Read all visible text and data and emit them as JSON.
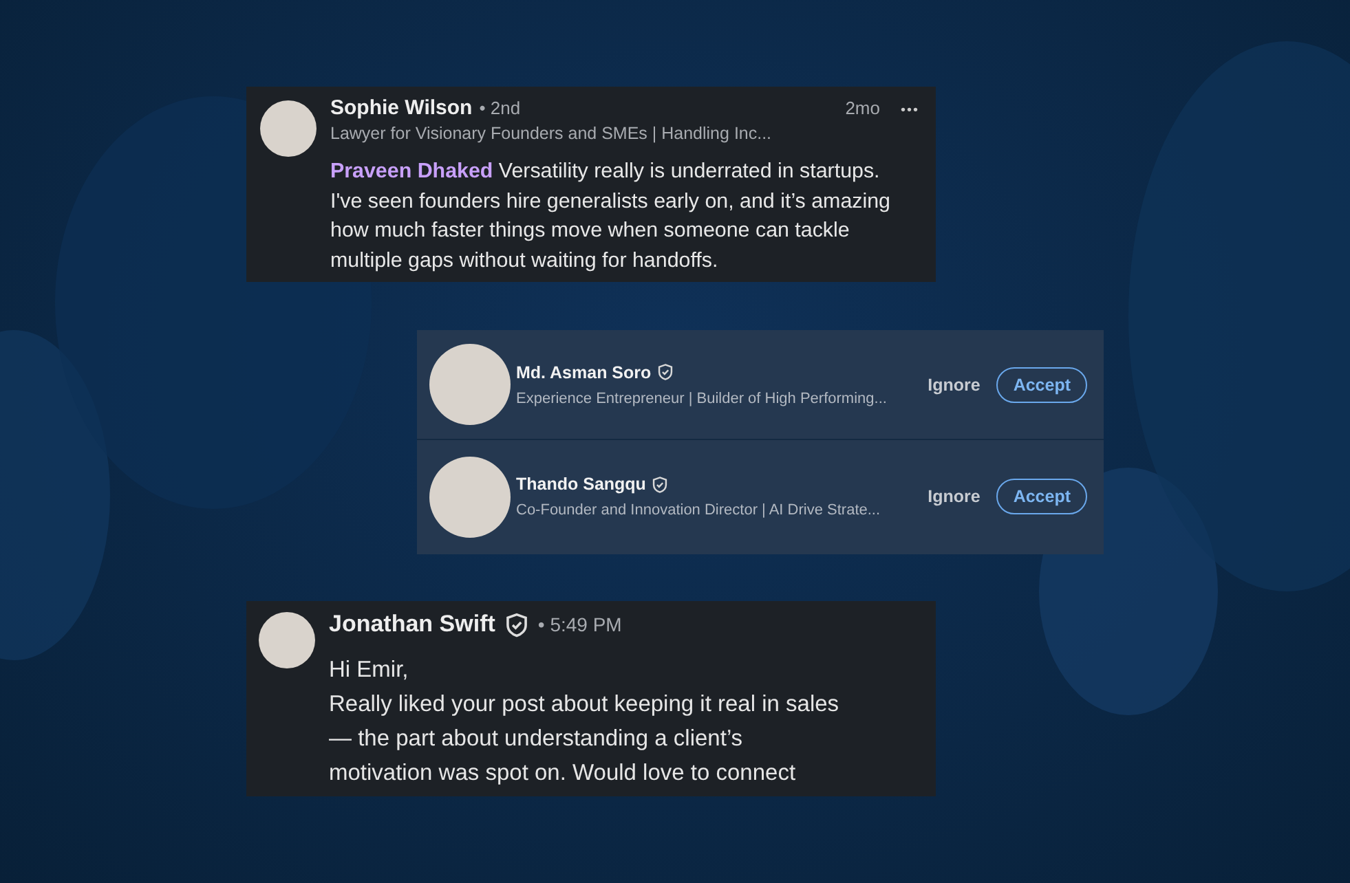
{
  "comment": {
    "author": "Sophie Wilson",
    "degree": "• 2nd",
    "headline": "Lawyer for Visionary Founders and SMEs | Handling Inc...",
    "time": "2mo",
    "more": "•••",
    "mention": "Praveen Dhaked",
    "text": "Versatility really is underrated in startups. I've seen founders hire generalists early on, and it’s amazing how much faster things move when someone can tackle multiple gaps without waiting for handoffs."
  },
  "invitations": [
    {
      "name": "Md. Asman Soro",
      "verified": true,
      "headline": "Experience Entrepreneur | Builder of High Performing...",
      "ignore": "Ignore",
      "accept": "Accept"
    },
    {
      "name": "Thando Sangqu",
      "verified": true,
      "headline": "Co-Founder and Innovation Director | AI Drive Strate...",
      "ignore": "Ignore",
      "accept": "Accept"
    }
  ],
  "message": {
    "author": "Jonathan Swift",
    "verified": true,
    "time": "• 5:49 PM",
    "greeting": "Hi Emir,",
    "body": "Really liked your post about keeping it real in sales — the part about understanding a client’s motivation was spot on. Would love to connect"
  }
}
